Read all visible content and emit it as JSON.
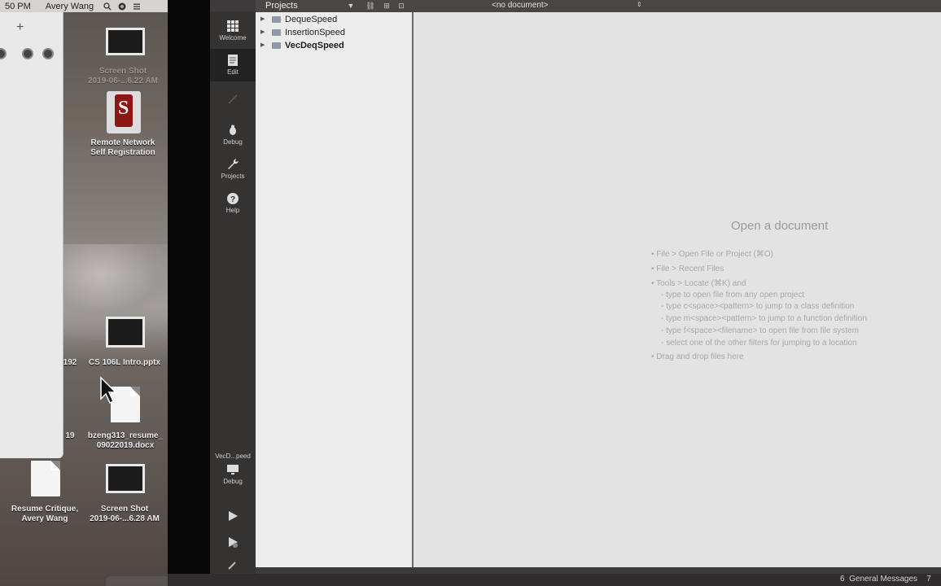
{
  "menubar": {
    "time": "50 PM",
    "user": "Avery Wang"
  },
  "desktop": {
    "icons": [
      {
        "label1": "Screen Shot",
        "label2": "2019-06-...6.22 AM"
      },
      {
        "label1": "Remote Network",
        "label2": "Self Registration"
      },
      {
        "label1": "CS 106L Intro.pptx",
        "label2": ""
      },
      {
        "label1": "bzeng313_resume_",
        "label2": "09022019.docx"
      },
      {
        "label1": "Resume Critique,",
        "label2": "Avery Wang"
      },
      {
        "label1": "Screen Shot",
        "label2": "2019-06-...6.28 AM"
      }
    ],
    "partial_192": "192",
    "partial_19": "19"
  },
  "qt": {
    "projects_title": "Projects",
    "no_document": "<no document>",
    "modes": [
      "Welcome",
      "Edit",
      "Debug",
      "Projects",
      "Help"
    ],
    "target": {
      "name": "VecD...peed",
      "label": "Debug"
    },
    "projects": [
      {
        "name": "DequeSpeed",
        "bold": false
      },
      {
        "name": "InsertionSpeed",
        "bold": false
      },
      {
        "name": "VecDeqSpeed",
        "bold": true
      }
    ],
    "editor": {
      "title": "Open a document",
      "hints": [
        "• File > Open File or Project (⌘O)",
        "• File > Recent Files",
        "• Tools > Locate (⌘K) and",
        "- type to open file from any open project",
        "- type c<space><pattern> to jump to a class definition",
        "- type m<space><pattern> to jump to a function definition",
        "- type f<space><filename> to open file from file system",
        "- select one of the other filters for jumping to a location",
        "• Drag and drop files here"
      ]
    },
    "status": {
      "general_messages": "General Messages",
      "count": "7",
      "num": "6"
    }
  },
  "colors": {
    "qt_dark": "#3c3a3a",
    "editor_bg": "#e3e3e3",
    "tree_bg": "#ececec"
  }
}
